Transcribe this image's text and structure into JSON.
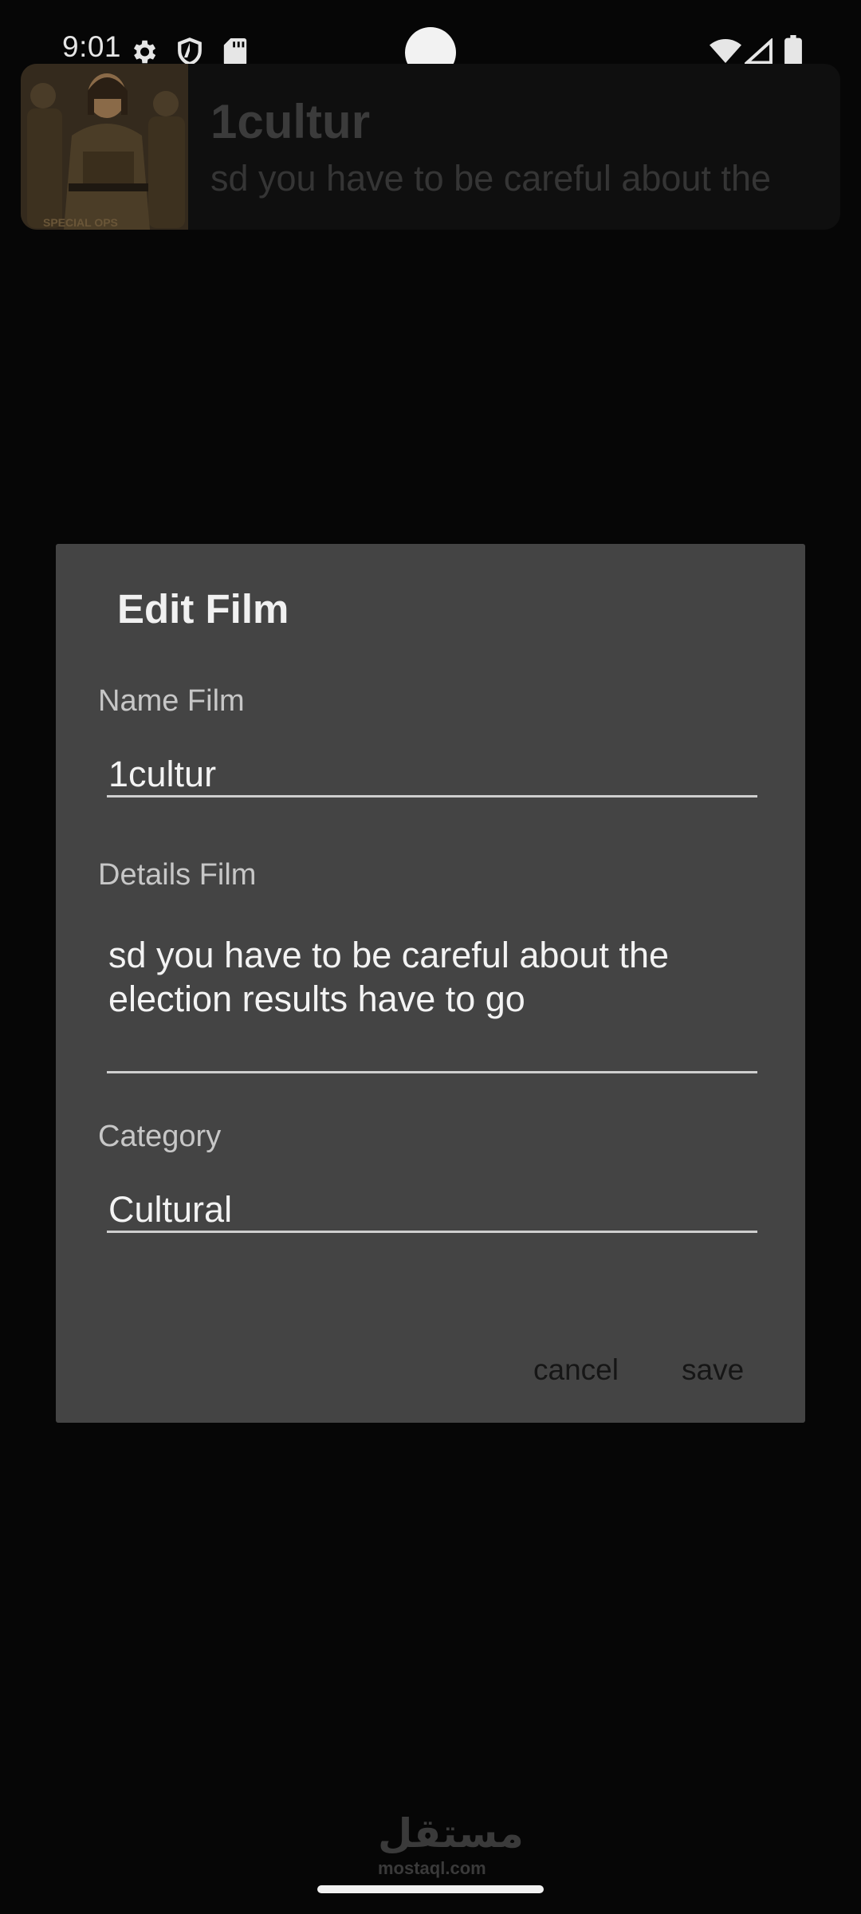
{
  "status_bar": {
    "time": "9:01",
    "icons": [
      "gear-icon",
      "shield-icon",
      "sd-card-icon",
      "wifi-icon",
      "signal-icon",
      "battery-icon"
    ]
  },
  "film_item": {
    "title": "1cultur",
    "description": "sd you have to be careful about the"
  },
  "dialog": {
    "title": "Edit Film",
    "name_label": "Name Film",
    "name_value": "1cultur",
    "details_label": "Details Film",
    "details_value": "sd you have to be careful about the\nelection results have to go",
    "category_label": "Category",
    "category_value": "Cultural",
    "cancel_label": "cancel",
    "save_label": "save"
  },
  "watermark": {
    "arabic": "مستقل",
    "latin": "mostaql.com"
  },
  "colors": {
    "background": "#060606",
    "dialog_bg": "#444444",
    "text_primary": "#f1f1f1",
    "text_secondary": "#c7c7c7",
    "button_text": "#161616"
  }
}
